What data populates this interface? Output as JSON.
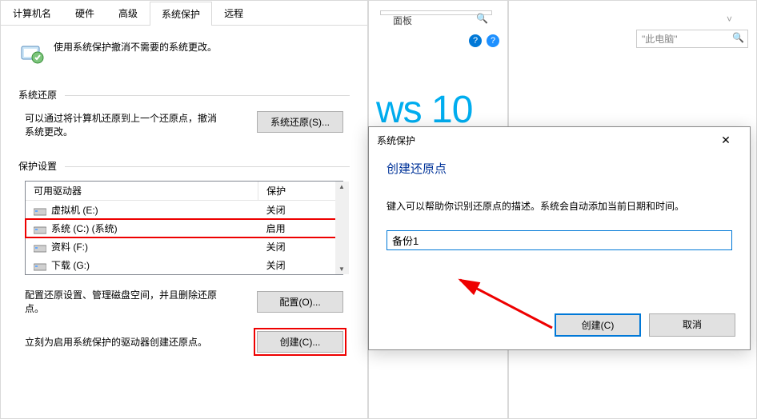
{
  "tabs": [
    "计算机名",
    "硬件",
    "高级",
    "系统保护",
    "远程"
  ],
  "active_tab_index": 3,
  "intro": "使用系统保护撤消不需要的系统更改。",
  "restore": {
    "title": "系统还原",
    "desc": "可以通过将计算机还原到上一个还原点，撤消系统更改。",
    "button": "系统还原(S)..."
  },
  "protection": {
    "title": "保护设置",
    "columns": {
      "drive": "可用驱动器",
      "status": "保护"
    },
    "rows": [
      {
        "name": "虚拟机 (E:)",
        "status": "关闭",
        "highlight": false
      },
      {
        "name": "系统 (C:) (系统)",
        "status": "启用",
        "highlight": true
      },
      {
        "name": "资料 (F:)",
        "status": "关闭",
        "highlight": false
      },
      {
        "name": "下载 (G:)",
        "status": "关闭",
        "highlight": false
      }
    ],
    "configure_desc": "配置还原设置、管理磁盘空间，并且删除还原点。",
    "configure_btn": "配置(O)...",
    "create_desc": "立刻为启用系统保护的驱动器创建还原点。",
    "create_btn": "创建(C)..."
  },
  "bg": {
    "panel_text": "面板",
    "search_placeholder": "\"此电脑\"",
    "win10_fragment": "ws 10"
  },
  "modal": {
    "title": "系统保护",
    "heading": "创建还原点",
    "desc": "键入可以帮助你识别还原点的描述。系统会自动添加当前日期和时间。",
    "input_value": "备份1",
    "create": "创建(C)",
    "cancel": "取消"
  }
}
